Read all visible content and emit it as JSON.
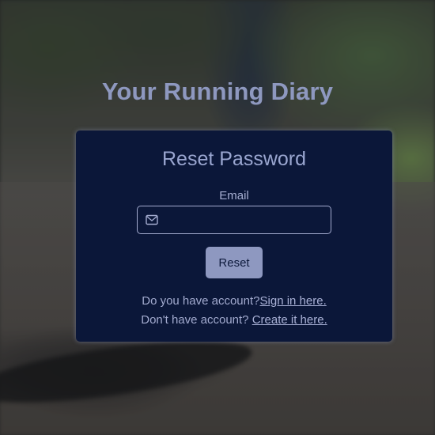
{
  "app": {
    "title": "Your Running Diary"
  },
  "form": {
    "heading": "Reset Password",
    "email_label": "Email",
    "email_value": "",
    "email_placeholder": "",
    "submit_label": "Reset"
  },
  "links": {
    "signin_prompt": "Do you have account?",
    "signin_link": "Sign in here.",
    "signup_prompt": "Don't have account? ",
    "signup_link": "Create it here."
  },
  "icons": {
    "email_field_icon": "envelope-icon"
  },
  "colors": {
    "card_background": "#0b1739",
    "accent": "#8e98c0",
    "text": "#a3abcf"
  }
}
